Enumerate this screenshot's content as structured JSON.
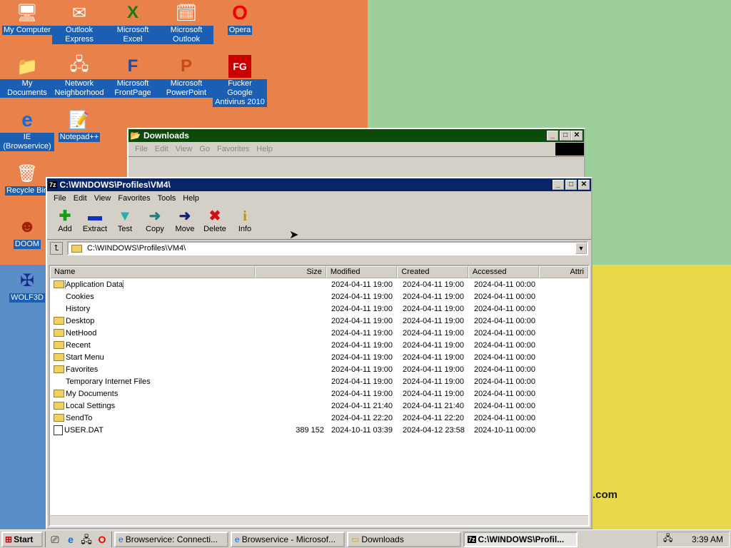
{
  "desktop": {
    "icons": [
      {
        "label": "My Computer",
        "icon": "computer-icon"
      },
      {
        "label": "Outlook Express",
        "icon": "outlook-express-icon"
      },
      {
        "label": "Microsoft Excel",
        "icon": "excel-icon"
      },
      {
        "label": "Microsoft Outlook",
        "icon": "outlook-icon"
      },
      {
        "label": "Opera",
        "icon": "opera-icon"
      },
      {
        "label": "My Documents",
        "icon": "documents-icon"
      },
      {
        "label": "Network Neighborhood",
        "icon": "network-icon"
      },
      {
        "label": "Microsoft FrontPage",
        "icon": "frontpage-icon"
      },
      {
        "label": "Microsoft PowerPoint",
        "icon": "powerpoint-icon"
      },
      {
        "label": "Fucker Google Antivirus 2010",
        "icon": "antivirus-icon"
      },
      {
        "label": "IE (Browservice)",
        "icon": "ie-icon"
      },
      {
        "label": "Notepad++",
        "icon": "notepad-icon"
      },
      {
        "label": "Recycle Bin",
        "icon": "recycle-bin-icon"
      },
      {
        "label": "DOOM",
        "icon": "doom-icon"
      },
      {
        "label": "WOLF3D",
        "icon": "wolf3d-icon"
      }
    ],
    "wallpaper_text": ".com"
  },
  "downloads_window": {
    "title": "Downloads",
    "menu": [
      "File",
      "Edit",
      "View",
      "Go",
      "Favorites",
      "Help"
    ]
  },
  "zip_window": {
    "title": "C:\\WINDOWS\\Profiles\\VM4\\",
    "menu": [
      "File",
      "Edit",
      "View",
      "Favorites",
      "Tools",
      "Help"
    ],
    "toolbar": [
      {
        "label": "Add",
        "icon": "plus-icon",
        "glyph": "✚",
        "color": "#10a010"
      },
      {
        "label": "Extract",
        "icon": "minus-icon",
        "glyph": "▬",
        "color": "#1030c0"
      },
      {
        "label": "Test",
        "icon": "test-icon",
        "glyph": "▼",
        "color": "#20b0b0"
      },
      {
        "label": "Copy",
        "icon": "copy-arrow-icon",
        "glyph": "➜",
        "color": "#208080"
      },
      {
        "label": "Move",
        "icon": "move-arrow-icon",
        "glyph": "➜",
        "color": "#102080"
      },
      {
        "label": "Delete",
        "icon": "delete-icon",
        "glyph": "✖",
        "color": "#d01010"
      },
      {
        "label": "Info",
        "icon": "info-icon",
        "glyph": "i",
        "color": "#c09000"
      }
    ],
    "address": "C:\\WINDOWS\\Profiles\\VM4\\",
    "columns": [
      "Name",
      "Size",
      "Modified",
      "Created",
      "Accessed",
      "Attri"
    ],
    "rows": [
      {
        "name": "Application Data",
        "type": "folder",
        "size": "",
        "modified": "2024-04-11 19:00",
        "created": "2024-04-11 19:00",
        "accessed": "2024-04-11 00:00"
      },
      {
        "name": "Cookies",
        "type": "none",
        "size": "",
        "modified": "2024-04-11 19:00",
        "created": "2024-04-11 19:00",
        "accessed": "2024-04-11 00:00"
      },
      {
        "name": "History",
        "type": "none",
        "size": "",
        "modified": "2024-04-11 19:00",
        "created": "2024-04-11 19:00",
        "accessed": "2024-04-11 00:00"
      },
      {
        "name": "Desktop",
        "type": "folder",
        "size": "",
        "modified": "2024-04-11 19:00",
        "created": "2024-04-11 19:00",
        "accessed": "2024-04-11 00:00"
      },
      {
        "name": "NetHood",
        "type": "folder",
        "size": "",
        "modified": "2024-04-11 19:00",
        "created": "2024-04-11 19:00",
        "accessed": "2024-04-11 00:00"
      },
      {
        "name": "Recent",
        "type": "folder",
        "size": "",
        "modified": "2024-04-11 19:00",
        "created": "2024-04-11 19:00",
        "accessed": "2024-04-11 00:00"
      },
      {
        "name": "Start Menu",
        "type": "folder",
        "size": "",
        "modified": "2024-04-11 19:00",
        "created": "2024-04-11 19:00",
        "accessed": "2024-04-11 00:00"
      },
      {
        "name": "Favorites",
        "type": "folder",
        "size": "",
        "modified": "2024-04-11 19:00",
        "created": "2024-04-11 19:00",
        "accessed": "2024-04-11 00:00"
      },
      {
        "name": "Temporary Internet Files",
        "type": "none",
        "size": "",
        "modified": "2024-04-11 19:00",
        "created": "2024-04-11 19:00",
        "accessed": "2024-04-11 00:00"
      },
      {
        "name": "My Documents",
        "type": "folder",
        "size": "",
        "modified": "2024-04-11 19:00",
        "created": "2024-04-11 19:00",
        "accessed": "2024-04-11 00:00"
      },
      {
        "name": "Local Settings",
        "type": "folder",
        "size": "",
        "modified": "2024-04-11 21:40",
        "created": "2024-04-11 21:40",
        "accessed": "2024-04-11 00:00"
      },
      {
        "name": "SendTo",
        "type": "folder",
        "size": "",
        "modified": "2024-04-11 22:20",
        "created": "2024-04-11 22:20",
        "accessed": "2024-04-11 00:00"
      },
      {
        "name": "USER.DAT",
        "type": "file",
        "size": "389 152",
        "modified": "2024-10-11 03:39",
        "created": "2024-04-12 23:58",
        "accessed": "2024-10-11 00:00"
      }
    ]
  },
  "taskbar": {
    "start_label": "Start",
    "tasks": [
      {
        "label": "Browservice: Connecti...",
        "active": false,
        "icon": "ie-icon"
      },
      {
        "label": "Browservice - Microsof...",
        "active": false,
        "icon": "ie-icon"
      },
      {
        "label": "Downloads",
        "active": false,
        "icon": "folder-icon"
      },
      {
        "label": "C:\\WINDOWS\\Profil...",
        "active": true,
        "icon": "7zip-icon"
      }
    ],
    "clock": "3:39 AM"
  },
  "colors": {
    "active_title": "#0a246a",
    "downloads_title": "#0b4a0b",
    "selection": "#1a5fb4"
  }
}
